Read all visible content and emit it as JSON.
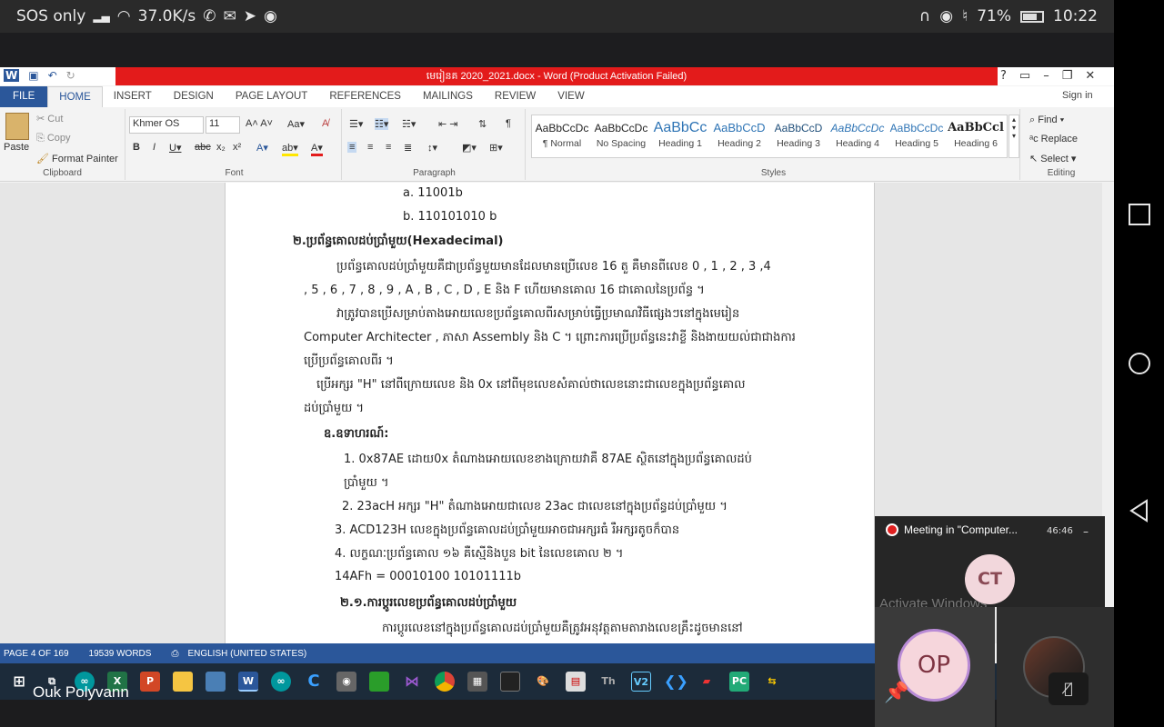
{
  "status_bar": {
    "left_text": "SOS only",
    "speed": "37.0K/s",
    "battery": "71%",
    "time": "10:22"
  },
  "word": {
    "title": "មេរៀនគ 2020_2021.docx - Word (Product Activation Failed)",
    "tabs": [
      "FILE",
      "HOME",
      "INSERT",
      "DESIGN",
      "PAGE LAYOUT",
      "REFERENCES",
      "MAILINGS",
      "REVIEW",
      "VIEW"
    ],
    "sign_in": "Sign in",
    "clipboard": {
      "paste": "Paste",
      "cut": "Cut",
      "copy": "Copy",
      "format_painter": "Format Painter",
      "label": "Clipboard"
    },
    "font": {
      "name": "Khmer OS",
      "size": "11",
      "label": "Font"
    },
    "paragraph_label": "Paragraph",
    "styles": [
      {
        "preview": "AaBbCcDc",
        "name": "¶ Normal"
      },
      {
        "preview": "AaBbCcDc",
        "name": "No Spacing"
      },
      {
        "preview": "AaBbCc",
        "name": "Heading 1"
      },
      {
        "preview": "AaBbCcD",
        "name": "Heading 2"
      },
      {
        "preview": "AaBbCcD",
        "name": "Heading 3"
      },
      {
        "preview": "AaBbCcDc",
        "name": "Heading 4"
      },
      {
        "preview": "AaBbCcDc",
        "name": "Heading 5"
      },
      {
        "preview": "AaBbCcl",
        "name": "Heading 6"
      }
    ],
    "styles_label": "Styles",
    "editing": {
      "find": "Find",
      "replace": "Replace",
      "select": "Select",
      "label": "Editing"
    },
    "doc_lines": [
      "a.   11001b",
      "b.   110101010 b",
      "២.ប្រព័ន្ធគោលដប់ប្រាំមួយ(Hexadecimal)",
      "ប្រព័ន្ធគោលដប់ប្រាំមួយគឺជាប្រព័ន្ធមួយមានដែលមានប្រើលេខ 16 តួ គឺមានពីលេខ 0 , 1 , 2 , 3 ,4",
      ", 5 , 6 , 7 , 8 , 9 , A , B , C , D , E និង F ហើយមានគោល 16 ជាគោលនៃប្រព័ន្ធ ។",
      "វាត្រូវបានប្រើសម្រាប់តាងអោយលេខប្រព័ន្ធគោលពីរសម្រាប់ធ្វើប្រមាណវិធីផ្សេងៗនៅក្នុងមេរៀន",
      "Computer Architecter , ភាសា Assembly និង C ។ ព្រោះការប្រើប្រព័ន្ធនេះវាខ្លី និងងាយយល់ជាជាងការ",
      "ប្រើប្រព័ន្ធគោលពីរ ។",
      "ប្រើអក្សរ \"H\" នៅពីក្រោយលេខ និង 0x នៅពីមុខលេខសំគាល់ថាលេខនោះជាលេខក្នុងប្រព័ន្ធគោល",
      "ដប់ប្រាំមួយ ។",
      "ឧ.ឧទាហរណ៍:",
      "1.  0x87AE  ដោយ0x  តំណាងអោយលេខខាងក្រោយវាគឺ  87AE  ស្ថិតនៅក្នុងប្រព័ន្ធគោលដប់",
      "ប្រាំមួយ ។",
      "2. 23acH អក្សរ \"H\" តំណាងអោយជាលេខ 23ac ជាលេខនៅក្នុងប្រព័ន្ធដប់ប្រាំមួយ ។",
      "3. ACD123H លេខក្នុងប្រព័ន្ធគោលដប់ប្រាំមួយអាចជាអក្សរធំ រឺអក្សរតូចក៏បាន",
      "4. លក្ខណៈប្រព័ន្ធគោល ១៦ គឺស្មើនិងបួន bit នៃលេខគោល ២ ។",
      "14AFh = 00010100 10101111b",
      "២.១.ការប្តូរលេខប្រព័ន្ធគោលដប់ប្រាំមួយ",
      "ការប្តូរលេខនៅក្នុងប្រព័ន្ធគោលដប់ប្រាំមួយគឺត្រូវអនុវត្តតាមតារាងលេខគ្រឹះដូចមាននៅ"
    ],
    "status": {
      "page": "PAGE 4 OF 169",
      "words": "19539 WORDS",
      "language": "ENGLISH (UNITED STATES)"
    }
  },
  "taskbar_user": "Ouk Polyvann",
  "meeting": {
    "title": "Meeting in \"Computer...",
    "time": "46:46",
    "initials_ct": "CT",
    "initials_op": "OP",
    "watermark": "Activate Windows"
  },
  "colors": {
    "word_blue": "#2b579a",
    "title_red": "#e31b1b"
  }
}
